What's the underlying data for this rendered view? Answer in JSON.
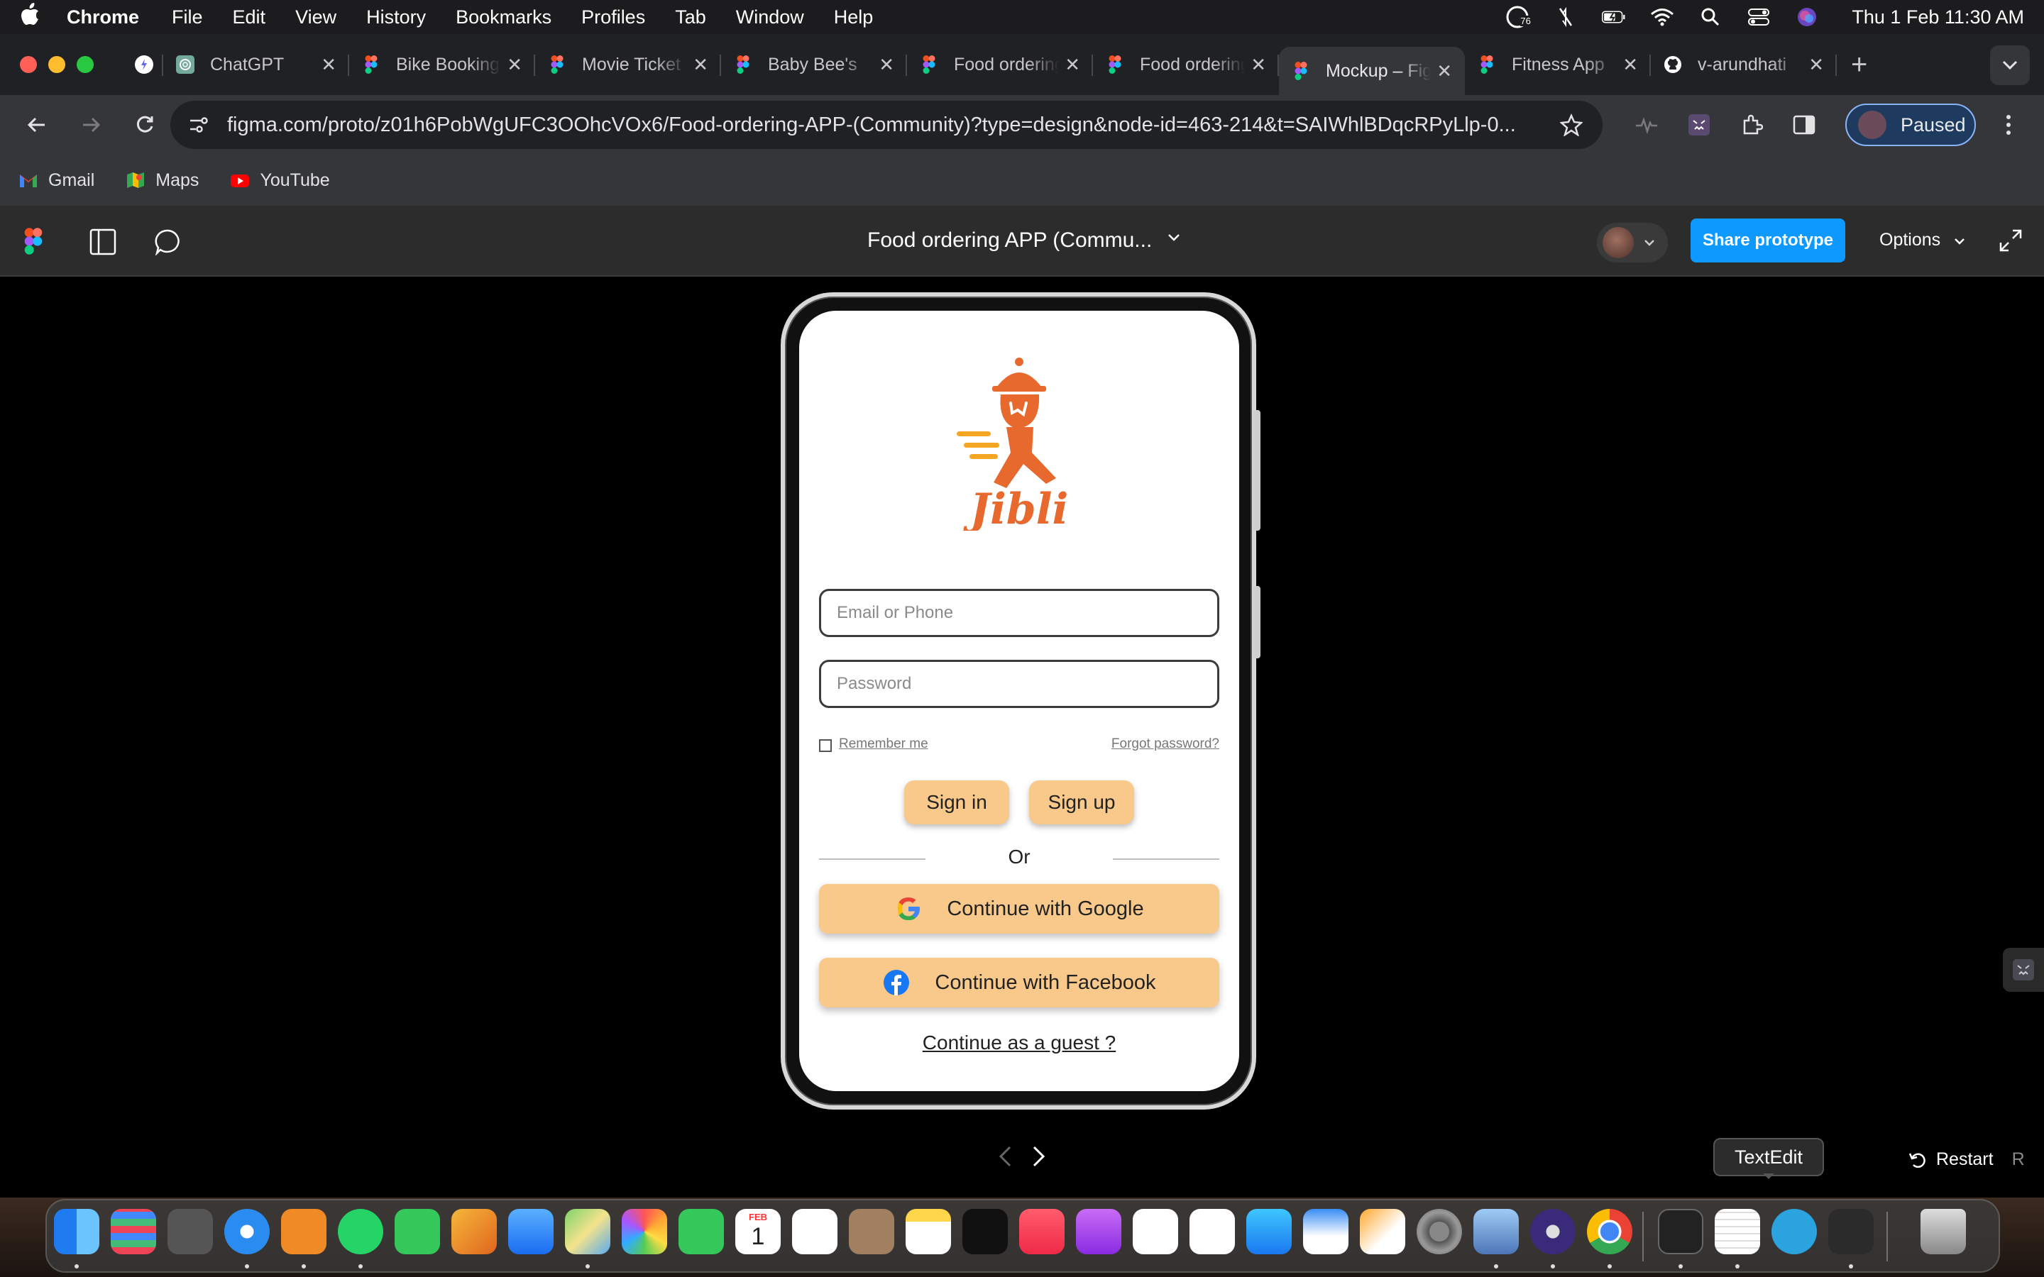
{
  "menubar": {
    "app": "Chrome",
    "items": [
      "File",
      "Edit",
      "View",
      "History",
      "Bookmarks",
      "Profiles",
      "Tab",
      "Window",
      "Help"
    ],
    "notification_count": "76",
    "clock": "Thu 1 Feb  11:30 AM"
  },
  "tabs": [
    {
      "title": "ChatGPT"
    },
    {
      "title": "Bike Booking"
    },
    {
      "title": "Movie Ticket"
    },
    {
      "title": "Baby Bee's"
    },
    {
      "title": "Food ordering"
    },
    {
      "title": "Food ordering"
    },
    {
      "title": "Mockup – Figma",
      "active": true
    },
    {
      "title": "Fitness App"
    },
    {
      "title": "v-arundhati"
    }
  ],
  "toolbar": {
    "url": "figma.com/proto/z01h6PobWgUFC3OOhcVOx6/Food-ordering-APP-(Community)?type=design&node-id=463-214&t=SAIWhlBDqcRPyLlp-0...",
    "profile_status": "Paused"
  },
  "bookmarks": [
    "Gmail",
    "Maps",
    "YouTube"
  ],
  "figma": {
    "file_title": "Food ordering APP (Commu...",
    "share_label": "Share prototype",
    "options_label": "Options",
    "restart_label": "Restart",
    "restart_key": "R"
  },
  "app_screen": {
    "brand": "Jibli",
    "email_placeholder": "Email or Phone",
    "password_placeholder": "Password",
    "remember_label": "Remember me",
    "forgot_label": "Forgot password?",
    "signin_label": "Sign in",
    "signup_label": "Sign up",
    "or_label": "Or",
    "google_label": "Continue with Google",
    "facebook_label": "Continue with Facebook",
    "guest_label": "Continue as a guest ?"
  },
  "colors": {
    "accent": "#f8c98a",
    "brand_orange": "#e8692e",
    "figma_blue": "#0d99ff"
  },
  "dock": {
    "tooltip": "TextEdit",
    "calendar_month": "FEB",
    "calendar_day": "1",
    "apps": [
      "finder",
      "launchpad",
      "keychain",
      "safari",
      "books",
      "whatsapp",
      "messages",
      "preview",
      "mail",
      "maps",
      "photos",
      "facetime",
      "calendar",
      "reminders",
      "contacts",
      "notes",
      "apple-tv",
      "music",
      "podcasts",
      "numbers",
      "vscode",
      "app-store",
      "keynote",
      "pages",
      "system-settings",
      "preview-2",
      "vpn",
      "chrome",
      "terminal",
      "textedit",
      "telegram",
      "sublime",
      "trash"
    ]
  }
}
